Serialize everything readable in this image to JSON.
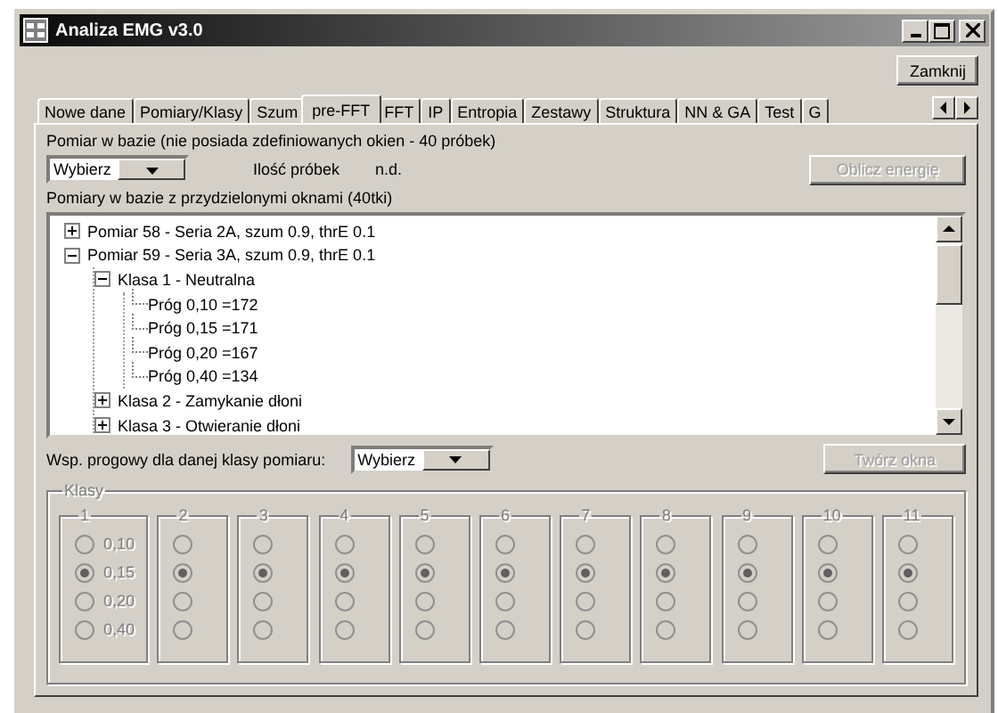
{
  "window": {
    "title": "Analiza EMG v3.0"
  },
  "close_button": "Zamknij",
  "tabs": [
    {
      "label": "Nowe dane",
      "selected": false
    },
    {
      "label": "Pomiary/Klasy",
      "selected": false
    },
    {
      "label": "Szum",
      "selected": false
    },
    {
      "label": "pre-FFT",
      "selected": true
    },
    {
      "label": "FFT",
      "selected": false
    },
    {
      "label": "IP",
      "selected": false
    },
    {
      "label": "Entropia",
      "selected": false
    },
    {
      "label": "Zestawy",
      "selected": false
    },
    {
      "label": "Struktura",
      "selected": false
    },
    {
      "label": "NN & GA",
      "selected": false
    },
    {
      "label": "Test",
      "selected": false
    },
    {
      "label": "G",
      "selected": false
    }
  ],
  "measurement": {
    "label": "Pomiar w bazie (nie posiada zdefiniowanych okien - 40 próbek)",
    "dropdown": "Wybierz",
    "count_label": "Ilość próbek",
    "count_value": "n.d.",
    "compute_button": {
      "label": "Oblicz energię",
      "disabled": true
    }
  },
  "tree": {
    "label": "Pomiary w bazie z przydzielonymi oknami (40tki)",
    "items": [
      {
        "label": "Pomiar 58 - Seria 2A, szum 0.9, thrE 0.1",
        "expanded": false
      },
      {
        "label": "Pomiar 59 - Seria 3A, szum 0.9, thrE 0.1",
        "expanded": true,
        "children": [
          {
            "label": "Klasa 1 - Neutralna",
            "expanded": true,
            "children": [
              {
                "label": "Próg 0,10 =172"
              },
              {
                "label": "Próg 0,15 =171"
              },
              {
                "label": "Próg 0,20 =167"
              },
              {
                "label": "Próg 0,40 =134"
              }
            ]
          },
          {
            "label": "Klasa 2 - Zamykanie dłoni",
            "expanded": false
          },
          {
            "label": "Klasa 3 - Otwieranie dłoni",
            "expanded": false
          }
        ]
      }
    ]
  },
  "threshold": {
    "label": "Wsp. progowy dla danej klasy pomiaru:",
    "dropdown": "Wybierz",
    "button": {
      "label": "Twórz okna",
      "disabled": true
    }
  },
  "classes": {
    "title": "Klasy",
    "disabled": true,
    "groups": [
      {
        "title": "1",
        "options": [
          {
            "label": "0,10",
            "selected": false
          },
          {
            "label": "0,15",
            "selected": true
          },
          {
            "label": "0,20",
            "selected": false
          },
          {
            "label": "0,40",
            "selected": false
          }
        ]
      },
      {
        "title": "2",
        "options": [
          {
            "selected": false
          },
          {
            "selected": true
          },
          {
            "selected": false
          },
          {
            "selected": false
          }
        ]
      },
      {
        "title": "3",
        "options": [
          {
            "selected": false
          },
          {
            "selected": true
          },
          {
            "selected": false
          },
          {
            "selected": false
          }
        ]
      },
      {
        "title": "4",
        "options": [
          {
            "selected": false
          },
          {
            "selected": true
          },
          {
            "selected": false
          },
          {
            "selected": false
          }
        ]
      },
      {
        "title": "5",
        "options": [
          {
            "selected": false
          },
          {
            "selected": true
          },
          {
            "selected": false
          },
          {
            "selected": false
          }
        ]
      },
      {
        "title": "6",
        "options": [
          {
            "selected": false
          },
          {
            "selected": true
          },
          {
            "selected": false
          },
          {
            "selected": false
          }
        ]
      },
      {
        "title": "7",
        "options": [
          {
            "selected": false
          },
          {
            "selected": true
          },
          {
            "selected": false
          },
          {
            "selected": false
          }
        ]
      },
      {
        "title": "8",
        "options": [
          {
            "selected": false
          },
          {
            "selected": true
          },
          {
            "selected": false
          },
          {
            "selected": false
          }
        ]
      },
      {
        "title": "9",
        "options": [
          {
            "selected": false
          },
          {
            "selected": true
          },
          {
            "selected": false
          },
          {
            "selected": false
          }
        ]
      },
      {
        "title": "10",
        "options": [
          {
            "selected": false
          },
          {
            "selected": true
          },
          {
            "selected": false
          },
          {
            "selected": false
          }
        ]
      },
      {
        "title": "11",
        "options": [
          {
            "selected": false
          },
          {
            "selected": true
          },
          {
            "selected": false
          },
          {
            "selected": false
          }
        ]
      }
    ]
  }
}
